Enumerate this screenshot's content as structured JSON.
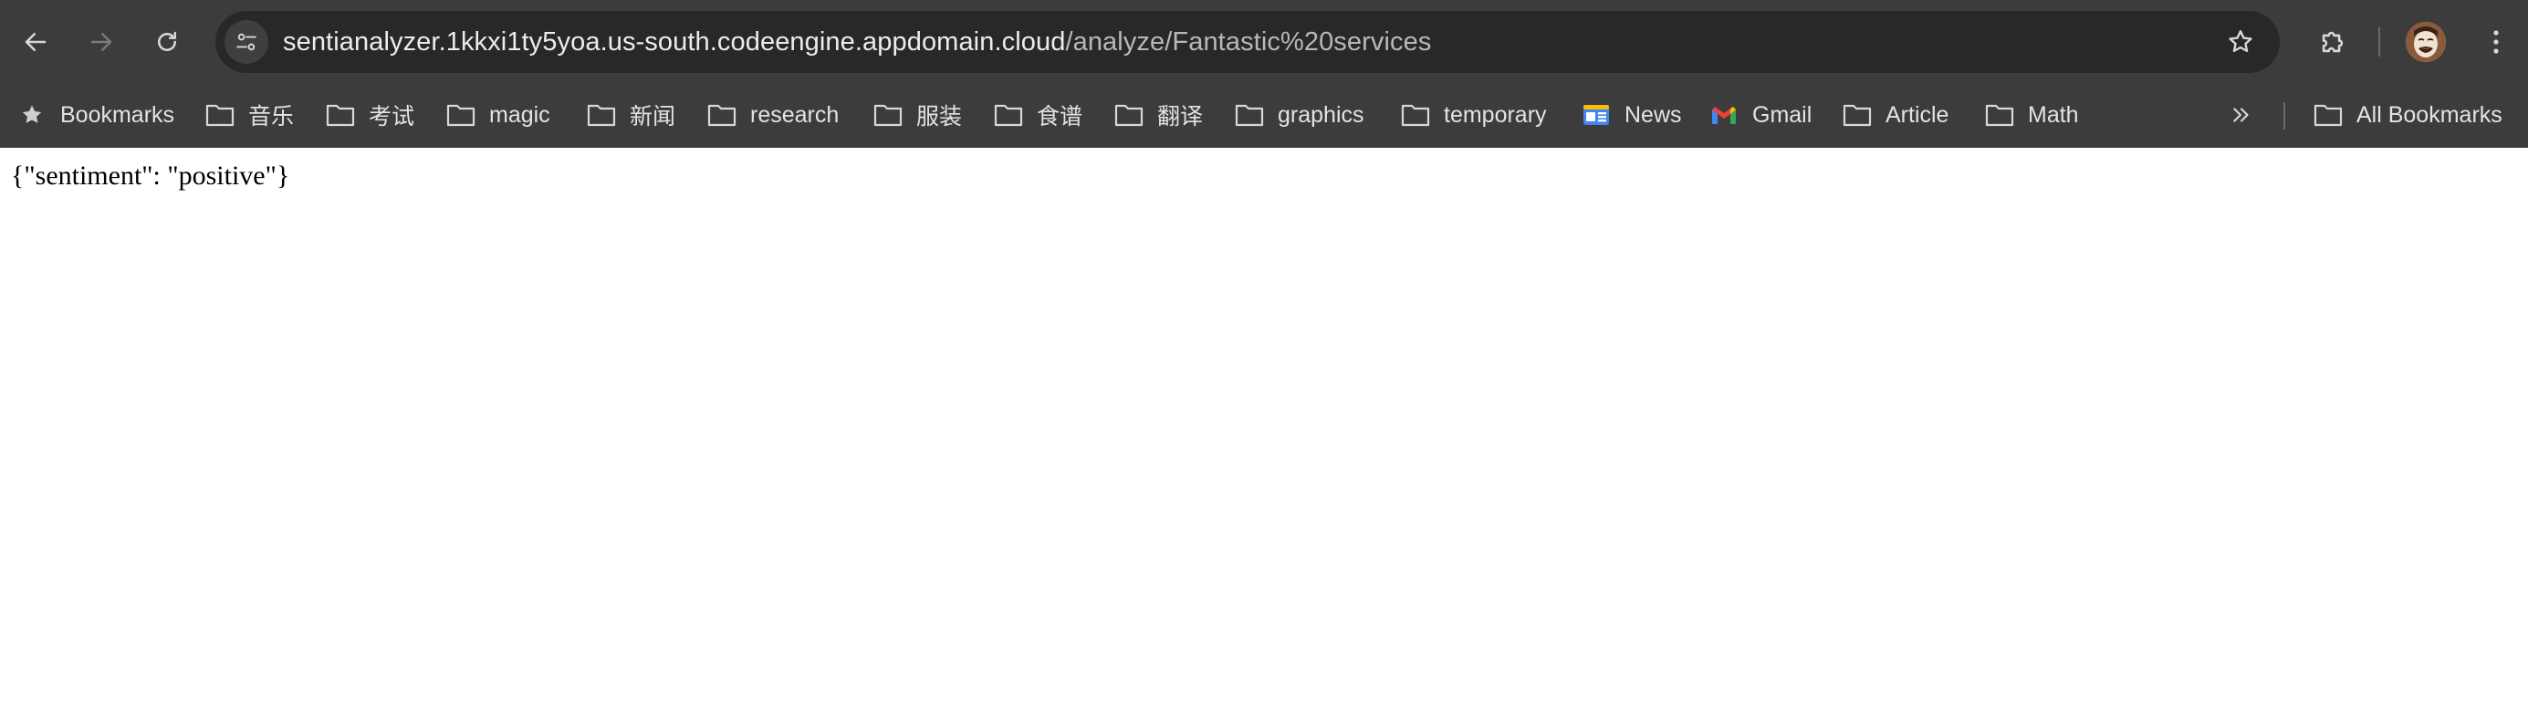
{
  "browser": {
    "url_host": "sentianalyzer.1kkxi1ty5yoa.us-south.codeengine.appdomain.cloud",
    "url_path": "/analyze/Fantastic%20services",
    "colors": {
      "toolbar_bg": "#3c3c3c",
      "omnibox_bg": "#282828",
      "text": "#e3e3e3"
    },
    "icons": {
      "back": "arrow-left-icon",
      "forward": "arrow-right-icon",
      "reload": "reload-icon",
      "site_info": "tune-icon",
      "star": "star-icon",
      "extensions": "puzzle-icon",
      "menu": "three-dot-menu-icon"
    }
  },
  "bookmarks": {
    "items": [
      {
        "label": "Bookmarks",
        "icon": "star-icon"
      },
      {
        "label": "音乐",
        "icon": "folder-icon"
      },
      {
        "label": "考试",
        "icon": "folder-icon"
      },
      {
        "label": "magic",
        "icon": "folder-icon"
      },
      {
        "label": "新闻",
        "icon": "folder-icon"
      },
      {
        "label": "research",
        "icon": "folder-icon"
      },
      {
        "label": "服装",
        "icon": "folder-icon"
      },
      {
        "label": "食谱",
        "icon": "folder-icon"
      },
      {
        "label": "翻译",
        "icon": "folder-icon"
      },
      {
        "label": "graphics",
        "icon": "folder-icon"
      },
      {
        "label": "temporary",
        "icon": "folder-icon"
      },
      {
        "label": "News",
        "icon": "google-news-icon"
      },
      {
        "label": "Gmail",
        "icon": "gmail-icon"
      },
      {
        "label": "Article",
        "icon": "folder-icon"
      },
      {
        "label": "Math",
        "icon": "folder-icon"
      }
    ],
    "all_bookmarks": "All Bookmarks"
  },
  "page": {
    "body_text": "{\"sentiment\": \"positive\"}"
  }
}
